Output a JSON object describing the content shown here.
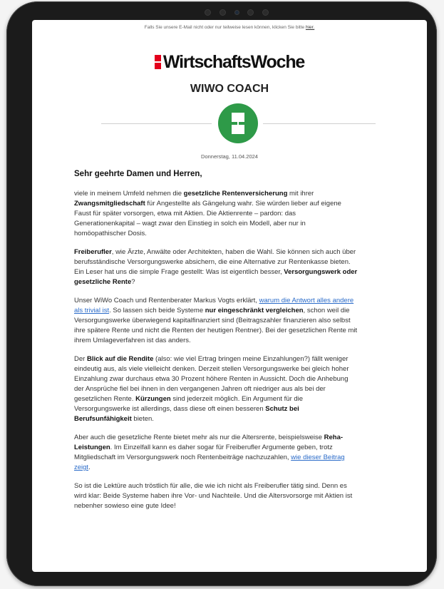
{
  "preheader": {
    "text": "Falls Sie unsere E-Mail nicht oder nur teilweise lesen können, klicken Sie bitte ",
    "link": "hier."
  },
  "brand": {
    "logo_text": "WirtschaftsWoche",
    "accent": "#e3001b"
  },
  "newsletter": {
    "title": "WIWO COACH",
    "icon": "coach-logo-icon",
    "icon_color": "#2e9a48"
  },
  "date": "Donnerstag, 11.04.2024",
  "greeting": "Sehr geehrte Damen und Herren,",
  "paragraphs": {
    "p1": {
      "t1": "viele in meinem Umfeld nehmen die ",
      "b1": "gesetzliche Rentenversicherung",
      "t2": " mit ihrer ",
      "b2": "Zwangsmitgliedschaft",
      "t3": " für Angestellte als Gängelung wahr. Sie würden lieber auf eigene Faust für später vorsorgen, etwa mit Aktien. Die Aktienrente – pardon: das Generationenkapital – wagt zwar den Einstieg in solch ein Modell, aber nur in homöopathischer Dosis."
    },
    "p2": {
      "b1": "Freiberufler",
      "t1": ", wie Ärzte, Anwälte oder Architekten, haben die Wahl. Sie können sich auch über berufsständische Versorgungswerke absichern, die eine Alternative zur Rentenkasse bieten. Ein Leser hat uns die simple Frage gestellt: Was ist eigentlich besser, ",
      "b2": "Versorgungswerk oder gesetzliche Rente",
      "t2": "?"
    },
    "p3": {
      "t1": "Unser WiWo Coach und Rentenberater Markus Vogts erklärt, ",
      "link": "warum die Antwort alles andere als trivial ist",
      "t2": ". So lassen sich beide Systeme ",
      "b1": "nur eingeschränkt vergleichen",
      "t3": ", schon weil die Versorgungswerke überwiegend kapitalfinanziert sind (Beitragszahler finanzieren also selbst ihre spätere Rente und nicht die Renten der heutigen Rentner). Bei der gesetzlichen Rente mit ihrem Umlageverfahren ist das anders."
    },
    "p4": {
      "t1": "Der ",
      "b1": "Blick auf die Rendite",
      "t2": " (also: wie viel Ertrag bringen meine Einzahlungen?) fällt weniger eindeutig aus, als viele vielleicht denken. Derzeit stellen Versorgungswerke bei gleich hoher Einzahlung zwar durchaus etwa 30 Prozent höhere Renten in Aussicht. Doch die Anhebung der Ansprüche fiel bei ihnen in den vergangenen Jahren oft niedriger aus als bei der gesetzlichen Rente. ",
      "b2": "Kürzungen",
      "t3": " sind jederzeit möglich. Ein Argument für die Versorgungswerke ist allerdings, dass diese oft einen besseren ",
      "b3": "Schutz bei Berufsunfähigkeit",
      "t4": " bieten."
    },
    "p5": {
      "t1": "Aber auch die gesetzliche Rente bietet mehr als nur die Altersrente, beispielsweise ",
      "b1": "Reha-Leistungen",
      "t2": ". Im Einzelfall kann es daher sogar für Freiberufler Argumente geben, trotz Mitgliedschaft im Versorgungswerk noch Rentenbeiträge nachzuzahlen, ",
      "link": "wie dieser Beitrag zeigt",
      "t3": "."
    },
    "p6": {
      "t1": "So ist die Lektüre auch tröstlich für alle, die wie ich nicht als Freiberufler tätig sind. Denn es wird klar: Beide Systeme haben ihre Vor- und Nachteile. Und die Altersvorsorge mit Aktien ist nebenher sowieso eine gute Idee!"
    }
  }
}
